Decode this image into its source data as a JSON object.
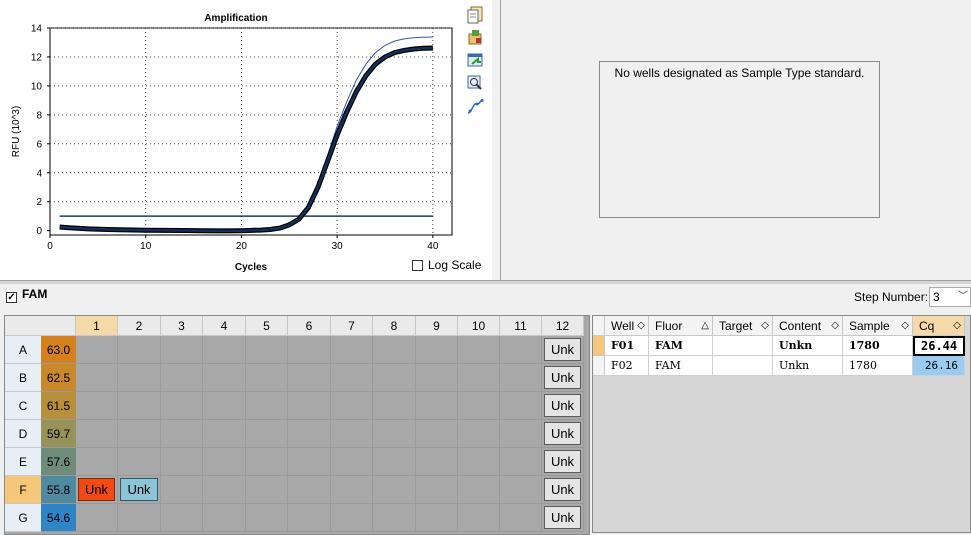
{
  "chart_data": {
    "type": "line",
    "title": "Amplification",
    "xlabel": "Cycles",
    "ylabel": "RFU (10^3)",
    "xlim": [
      0,
      42
    ],
    "ylim": [
      -0.3,
      14
    ],
    "xticks": [
      0,
      10,
      20,
      30,
      40
    ],
    "yticks": [
      0,
      2,
      4,
      6,
      8,
      10,
      12,
      14
    ],
    "grid": true,
    "threshold": 1.0,
    "series": [
      {
        "color": "#12305a",
        "emphasis": true,
        "x": [
          1,
          2,
          4,
          6,
          8,
          10,
          12,
          14,
          16,
          18,
          20,
          22,
          23,
          24,
          25,
          26,
          27,
          28,
          29,
          30,
          31,
          32,
          33,
          34,
          35,
          36,
          37,
          38,
          39,
          40
        ],
        "y": [
          0.25,
          0.2,
          0.12,
          0.08,
          0.05,
          0.03,
          0.02,
          0.01,
          0.0,
          -0.02,
          0.0,
          0.04,
          0.08,
          0.18,
          0.4,
          0.8,
          1.6,
          3.0,
          4.8,
          6.6,
          8.2,
          9.6,
          10.7,
          11.5,
          12.0,
          12.3,
          12.45,
          12.55,
          12.6,
          12.62
        ]
      },
      {
        "color": "#3355aa",
        "emphasis": false,
        "x": [
          1,
          2,
          4,
          6,
          8,
          10,
          12,
          14,
          16,
          18,
          20,
          22,
          23,
          24,
          25,
          26,
          27,
          28,
          29,
          30,
          31,
          32,
          33,
          34,
          35,
          36,
          37,
          38,
          39,
          40
        ],
        "y": [
          0.2,
          0.15,
          0.1,
          0.06,
          0.04,
          0.02,
          0.01,
          0.0,
          -0.01,
          -0.02,
          0.0,
          0.04,
          0.09,
          0.2,
          0.45,
          0.9,
          1.8,
          3.3,
          5.2,
          7.2,
          8.9,
          10.4,
          11.5,
          12.3,
          12.8,
          13.1,
          13.25,
          13.32,
          13.36,
          13.38
        ]
      }
    ]
  },
  "chart_ui": {
    "log_scale_label": "Log Scale"
  },
  "toolbar_icons": [
    "copy-icon",
    "export-icon",
    "save-image-icon",
    "zoom-icon",
    "curve-icon"
  ],
  "standard_curve": {
    "message": "No wells designated as Sample Type standard."
  },
  "fluor": {
    "label": "FAM",
    "checked": true
  },
  "step": {
    "label": "Step Number:",
    "value": "3"
  },
  "plate": {
    "columns": [
      "1",
      "2",
      "3",
      "4",
      "5",
      "6",
      "7",
      "8",
      "9",
      "10",
      "11",
      "12"
    ],
    "rows": [
      {
        "label": "A",
        "temp": "63.0",
        "color": "#d4801e"
      },
      {
        "label": "B",
        "temp": "62.5",
        "color": "#c9882a"
      },
      {
        "label": "C",
        "temp": "61.5",
        "color": "#b8903c"
      },
      {
        "label": "D",
        "temp": "59.7",
        "color": "#96925a"
      },
      {
        "label": "E",
        "temp": "57.6",
        "color": "#6f8c7a"
      },
      {
        "label": "F",
        "temp": "55.8",
        "color": "#4f8aa0"
      },
      {
        "label": "G",
        "temp": "54.6",
        "color": "#2f84c6"
      }
    ],
    "wells": {
      "A12": "Unk",
      "B12": "Unk",
      "C12": "Unk",
      "D12": "Unk",
      "E12": "Unk",
      "F1": "Unk",
      "F2": "Unk",
      "F12": "Unk",
      "G12": "Unk"
    }
  },
  "grid": {
    "headers": [
      "Well",
      "Fluor",
      "Target",
      "Content",
      "Sample",
      "Cq"
    ],
    "rows": [
      {
        "well": "F01",
        "fluor": "FAM",
        "target": "",
        "content": "Unkn",
        "sample": "1780",
        "cq": "26.44",
        "selected": true
      },
      {
        "well": "F02",
        "fluor": "FAM",
        "target": "",
        "content": "Unkn",
        "sample": "1780",
        "cq": "26.16",
        "selected": false
      }
    ]
  }
}
